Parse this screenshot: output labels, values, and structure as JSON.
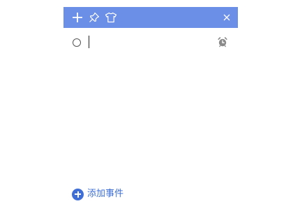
{
  "titlebar": {
    "color": "#6b8ee6",
    "icons": [
      "plus-icon",
      "pin-icon",
      "shirt-icon",
      "close-icon"
    ]
  },
  "task": {
    "value": "",
    "icon": "alarm-clock-icon"
  },
  "footer": {
    "add_label": "添加事件",
    "accent_color": "#3f6fd6"
  }
}
